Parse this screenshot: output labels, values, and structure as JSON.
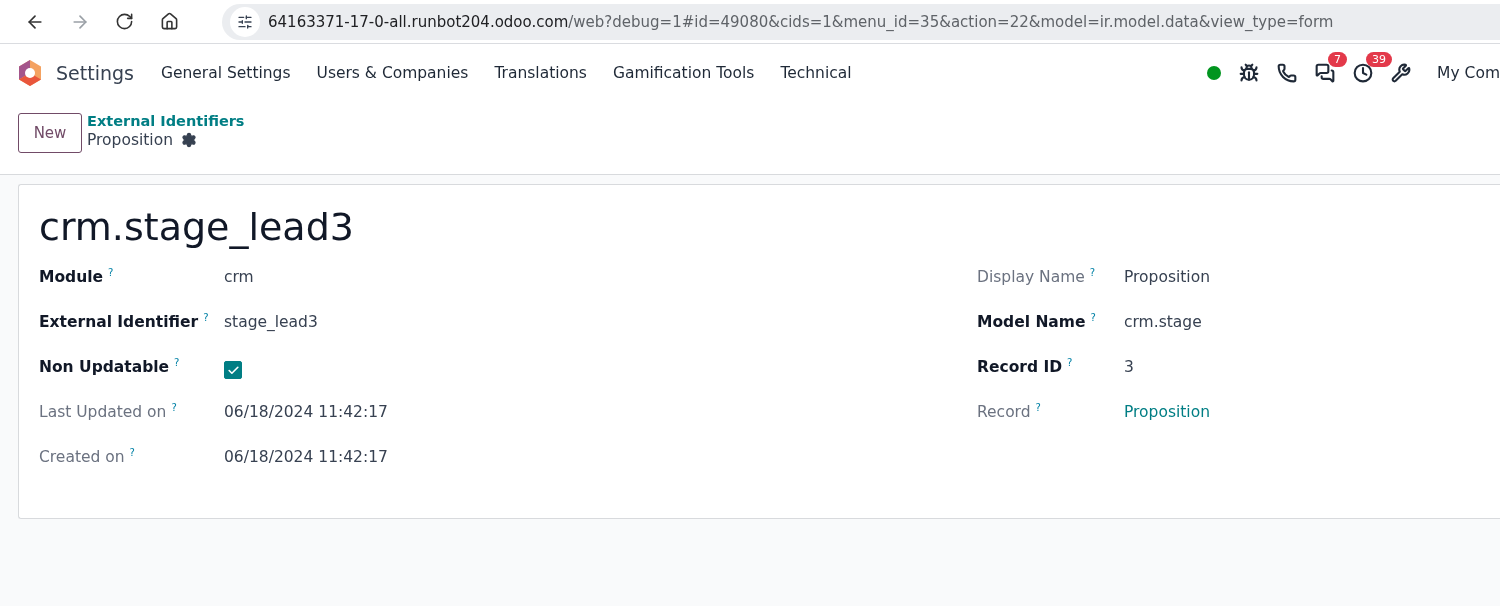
{
  "browser": {
    "url_host": "64163371-17-0-all.runbot204.odoo.com",
    "url_path": "/web?debug=1#id=49080&cids=1&menu_id=35&action=22&model=ir.model.data&view_type=form"
  },
  "navbar": {
    "app": "Settings",
    "menu": [
      "General Settings",
      "Users & Companies",
      "Translations",
      "Gamification Tools",
      "Technical"
    ],
    "systray": [
      {
        "kind": "status"
      },
      {
        "kind": "bug"
      },
      {
        "kind": "phone"
      },
      {
        "kind": "chat",
        "badge": "7"
      },
      {
        "kind": "clock",
        "badge": "39"
      },
      {
        "kind": "tools"
      }
    ],
    "company": "My Com"
  },
  "control_panel": {
    "new_button": "New",
    "breadcrumb": "External Identifiers",
    "current": "Proposition"
  },
  "record": {
    "title": "crm.stage_lead3",
    "left_fields": [
      {
        "label": "Module",
        "help": "?",
        "required": true,
        "kind": "text",
        "value": "crm"
      },
      {
        "label": "External Identifier",
        "help": "?",
        "required": true,
        "kind": "text",
        "value": "stage_lead3"
      },
      {
        "label": "Non Updatable",
        "help": "?",
        "required": true,
        "kind": "checkbox",
        "checked": true
      },
      {
        "label": "Last Updated on",
        "help": "?",
        "required": false,
        "kind": "text",
        "value": "06/18/2024 11:42:17"
      },
      {
        "label": "Created on",
        "help": "?",
        "required": false,
        "kind": "text",
        "value": "06/18/2024 11:42:17"
      }
    ],
    "right_fields": [
      {
        "label": "Display Name",
        "help": "?",
        "required": false,
        "kind": "text",
        "value": "Proposition"
      },
      {
        "label": "Model Name",
        "help": "?",
        "required": true,
        "kind": "text",
        "value": "crm.stage"
      },
      {
        "label": "Record ID",
        "help": "?",
        "required": true,
        "kind": "text",
        "value": "3"
      },
      {
        "label": "Record",
        "help": "?",
        "required": false,
        "kind": "link",
        "value": "Proposition"
      }
    ]
  }
}
